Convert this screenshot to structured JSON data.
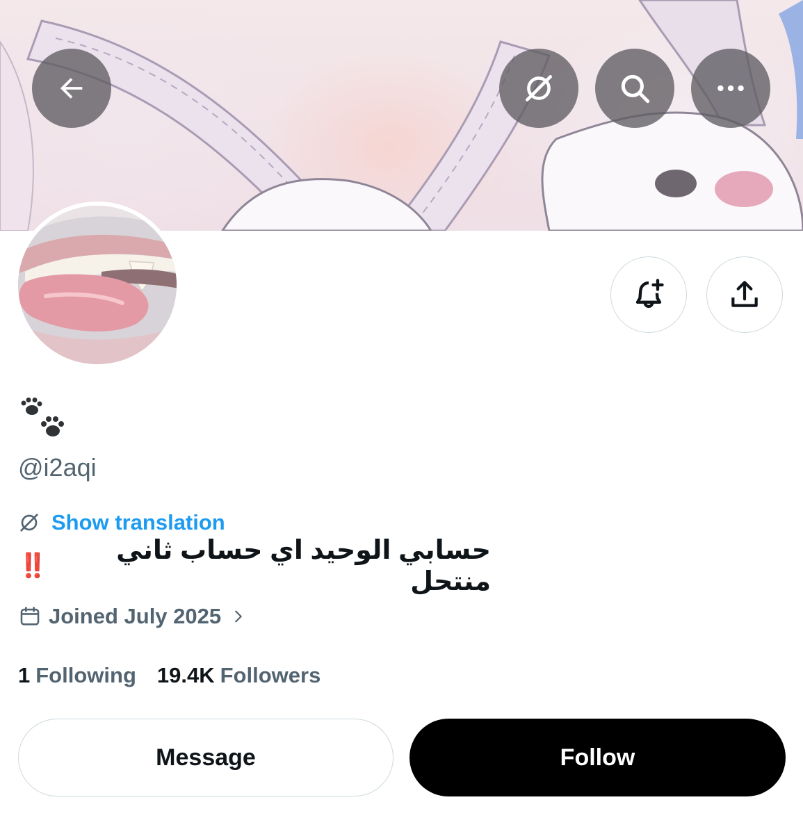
{
  "header": {
    "back_icon": "arrow-left-icon",
    "translate_icon": "translate-off-icon",
    "search_icon": "search-icon",
    "more_icon": "more-horizontal-icon"
  },
  "profile": {
    "display_name_emoji": "🐾",
    "handle": "@i2aqi",
    "show_translation_label": "Show translation",
    "bio_text": "حسابي الوحيد اي حساب ثاني منتحل",
    "bio_emoji": "‼️",
    "joined_label": "Joined July 2025",
    "following_count": "1",
    "following_label": "Following",
    "followers_count": "19.4K",
    "followers_label": "Followers"
  },
  "actions": {
    "notify_icon": "bell-plus-icon",
    "share_icon": "share-upload-icon",
    "message_label": "Message",
    "follow_label": "Follow"
  },
  "colors": {
    "accent": "#1d9bf0",
    "text_secondary": "#536471",
    "follow_bg": "#000000"
  }
}
